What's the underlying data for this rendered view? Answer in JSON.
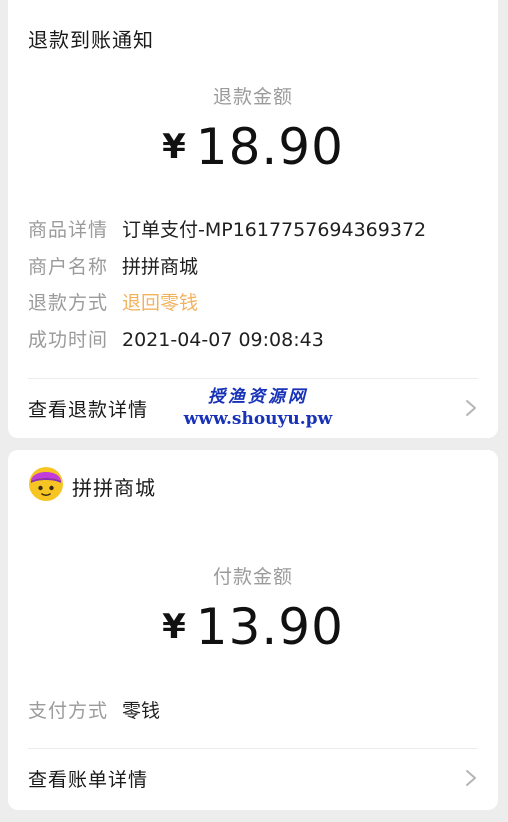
{
  "refund_card": {
    "title": "退款到账通知",
    "amount_label": "退款金额",
    "currency_symbol": "¥",
    "amount": "18.90",
    "details": [
      {
        "key": "商品详情",
        "value": "订单支付-MP1617757694369372"
      },
      {
        "key": "商户名称",
        "value": "拼拼商城"
      },
      {
        "key": "退款方式",
        "value": "退回零钱"
      },
      {
        "key": "成功时间",
        "value": "2021-04-07 09:08:43"
      }
    ],
    "link_label": "查看退款详情",
    "refund_method_color": "#f2b25c"
  },
  "watermark": {
    "line1": "授渔资源网",
    "line2": "www.shouyu.pw"
  },
  "pay_card": {
    "merchant_name": "拼拼商城",
    "avatar_icon": "merchant-avatar-icon",
    "amount_label": "付款金额",
    "currency_symbol": "¥",
    "amount": "13.90",
    "details": [
      {
        "key": "支付方式",
        "value": "零钱"
      }
    ],
    "link_label": "查看账单详情"
  }
}
